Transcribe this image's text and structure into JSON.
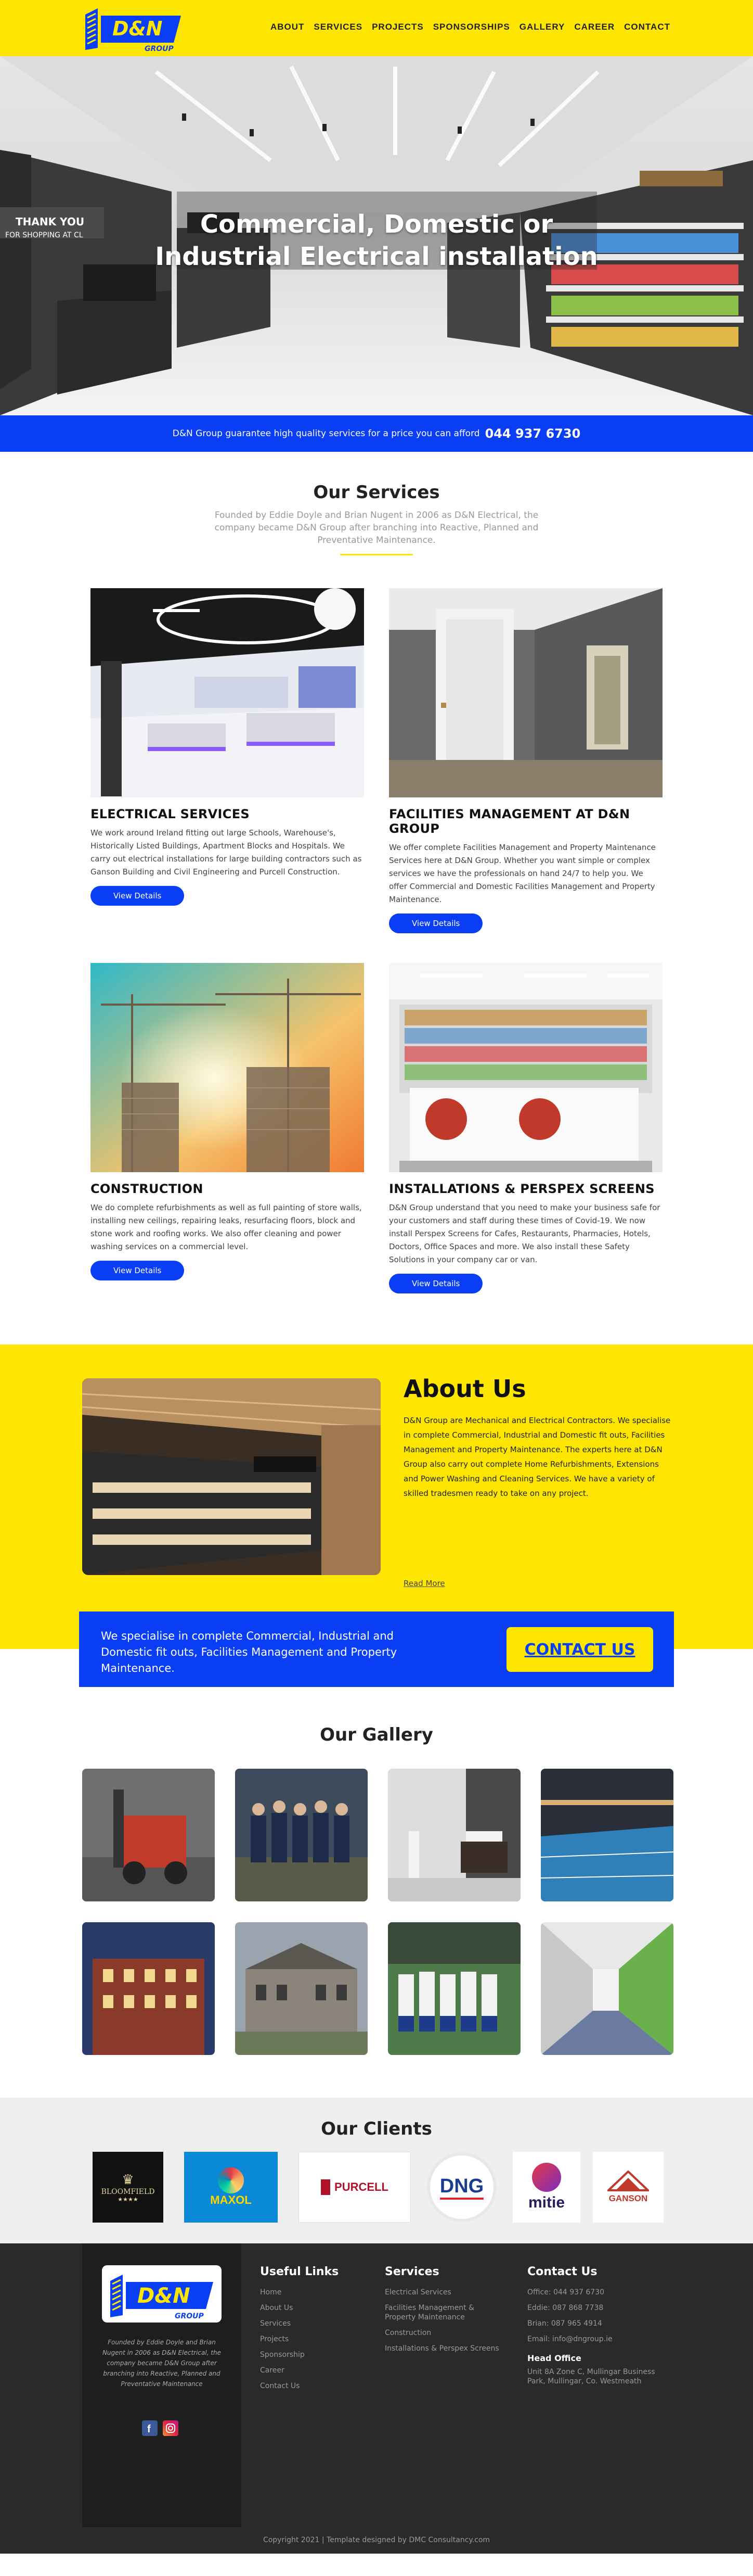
{
  "header": {
    "logo_text": "D&N",
    "logo_sub": "GROUP",
    "nav": [
      "ABOUT",
      "SERVICES",
      "PROJECTS",
      "SPONSORSHIPS",
      "GALLERY",
      "CAREER",
      "CONTACT"
    ]
  },
  "hero": {
    "title_line1": "Commercial, Domestic or",
    "title_line2": "Industrial Electrical installation",
    "sign_text_1": "THANK YOU",
    "sign_text_2": "FOR SHOPPING AT CL"
  },
  "strip": {
    "text": "D&N Group guarantee high quality services for a price you can afford",
    "phone": "044 937 6730"
  },
  "services": {
    "title": "Our Services",
    "subtitle": "Founded by Eddie Doyle and Brian Nugent in 2006 as D&N Electrical, the company became D&N Group after branching into Reactive, Planned and Preventative Maintenance.",
    "items": [
      {
        "title": "ELECTRICAL SERVICES",
        "text": "We work around Ireland fitting out large Schools, Warehouse's, Historically Listed Buildings, Apartment Blocks and Hospitals. We carry out electrical installations for large building contractors such as Ganson Building and Civil Engineering and Purcell Construction.",
        "button": "View Details"
      },
      {
        "title": "FACILITIES MANAGEMENT AT D&N GROUP",
        "text": "We offer complete Facilities Management and Property Maintenance Services here at D&N Group. Whether you want simple or complex services we have the professionals on hand 24/7 to help you. We offer Commercial and Domestic Facilities Management and Property Maintenance.",
        "button": "View Details"
      },
      {
        "title": "CONSTRUCTION",
        "text": "We do complete refurbishments as well as full painting of store walls, installing new ceilings, repairing leaks, resurfacing floors, block and stone work and roofing works. We also offer cleaning and power washing services on a commercial level.",
        "button": "View Details"
      },
      {
        "title": "INSTALLATIONS & PERSPEX SCREENS",
        "text": "D&N Group understand that you need to make your business safe for your customers and staff during these times of Covid-19. We now install Perspex Screens for Cafes, Restaurants, Pharmacies, Hotels, Doctors, Office Spaces and more. We also install these Safety Solutions in your company car or van.",
        "button": "View Details"
      }
    ]
  },
  "about": {
    "title": "About Us",
    "text": "D&N Group are Mechanical and Electrical Contractors. We specialise in complete Commercial, Industrial and Domestic fit outs, Facilities Management and Property Maintenance. The experts here at D&N Group also carry out complete Home Refurbishments, Extensions and Power Washing and Cleaning Services. We have a variety of skilled tradesmen ready to take on any project.",
    "read_more": "Read More"
  },
  "cta": {
    "text": "We specialise in complete Commercial, Industrial and Domestic fit outs, Facilities Management and Property Maintenance.",
    "button": "CONTACT US"
  },
  "gallery": {
    "title": "Our Gallery"
  },
  "clients": {
    "title": "Our Clients",
    "logos": [
      "BLOOMFIELD",
      "MAXOL",
      "PURCELL",
      "DNG",
      "mitie",
      "GANSON"
    ]
  },
  "footer": {
    "about": "Founded by Eddie Doyle and Brian Nugent in 2006 as D&N Electrical, the company became D&N Group after branching into Reactive, Planned and Preventative Maintenance",
    "useful_links_title": "Useful Links",
    "useful_links": [
      "Home",
      "About Us",
      "Services",
      "Projects",
      "Sponsorship",
      "Career",
      "Contact Us"
    ],
    "services_title": "Services",
    "services_links": [
      "Electrical Services",
      "Facilities Management & Property Maintenance",
      "Construction",
      "Installations & Perspex Screens"
    ],
    "contact_title": "Contact Us",
    "contact_lines": [
      "Office: 044 937 6730",
      "Eddie: 087 868 7738",
      "Brian: 087 965 4914",
      "Email: info@dngroup.ie"
    ],
    "head_office_title": "Head Office",
    "head_office": "Unit 8A Zone C, Mullingar Business Park, Mullingar, Co. Westmeath",
    "copyright": "Copyright 2021 | Template designed by DMC Consultancy.com"
  },
  "colors": {
    "brand_yellow": "#FEE600",
    "brand_blue": "#0A3EF5"
  }
}
